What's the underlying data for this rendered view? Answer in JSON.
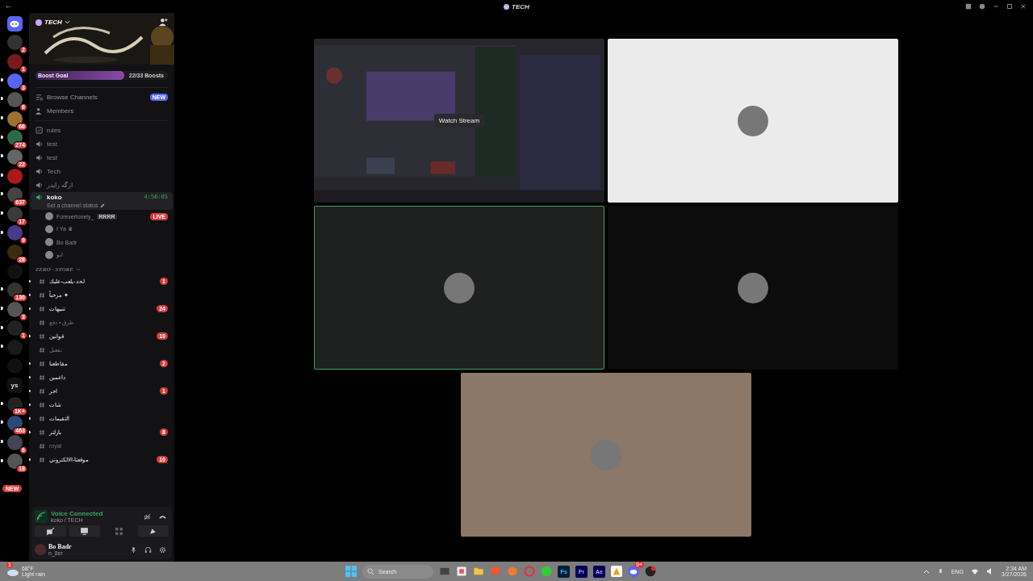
{
  "titlebar": {
    "title": "TECH"
  },
  "servers": [
    {
      "kind": "home",
      "unread": false
    },
    {
      "kind": "server",
      "badge": "2",
      "unread": false
    },
    {
      "kind": "server",
      "badge": "1",
      "unread": false
    },
    {
      "kind": "server",
      "badge": "3",
      "unread": true
    },
    {
      "kind": "server",
      "badge": "6",
      "unread": true
    },
    {
      "kind": "server",
      "badge": "66",
      "unread": true
    },
    {
      "kind": "server",
      "badge": "274",
      "unread": true
    },
    {
      "kind": "server",
      "badge": "22",
      "unread": true
    },
    {
      "kind": "server",
      "unread": true
    },
    {
      "kind": "server",
      "badge": "637",
      "unread": true
    },
    {
      "kind": "server",
      "badge": "17",
      "unread": true
    },
    {
      "kind": "server",
      "badge": "9",
      "unread": true
    },
    {
      "kind": "server",
      "badge": "28",
      "unread": false
    },
    {
      "kind": "server",
      "unread": false
    },
    {
      "kind": "server",
      "badge": "130",
      "unread": true
    },
    {
      "kind": "server",
      "badge": "3",
      "unread": true
    },
    {
      "kind": "server",
      "badge": "1",
      "unread": true
    },
    {
      "kind": "server",
      "unread": true
    },
    {
      "kind": "server",
      "unread": false
    },
    {
      "kind": "initials",
      "label": "ys",
      "unread": false
    },
    {
      "kind": "server",
      "badge": "1K+",
      "unread": true
    },
    {
      "kind": "server",
      "badge": "463",
      "unread": true
    },
    {
      "kind": "server",
      "badge": "6",
      "unread": true
    },
    {
      "kind": "server",
      "badge": "18",
      "unread": true
    }
  ],
  "new_pill": "NEW",
  "guild": {
    "name": "TECH",
    "boost_label": "Boost Goal",
    "level": 0.67,
    "boost_count": "22/33 Boosts"
  },
  "nav": [
    {
      "kind": "browse",
      "label": "Browse Channels",
      "badge": "NEW"
    },
    {
      "kind": "members",
      "label": "Members"
    }
  ],
  "channels": [
    {
      "kind": "rules",
      "name": "rules",
      "selected": false
    },
    {
      "kind": "voice",
      "name": "test",
      "selected": false
    },
    {
      "kind": "voice",
      "name": "test",
      "selected": false
    },
    {
      "kind": "voice",
      "name": "Tech",
      "selected": false
    },
    {
      "kind": "voice",
      "name": "ارگه رايدر",
      "selected": false
    },
    {
      "kind": "voice",
      "name": "koko",
      "selected": true,
      "timer": "4:56:05",
      "status": "Set a channel status"
    }
  ],
  "members": [
    {
      "name": "Foreverlonely_",
      "tag": "RRRR",
      "live": "LIVE"
    },
    {
      "name": "I Ya ♛"
    },
    {
      "name": "Bo Badr"
    },
    {
      "name": "ابو"
    }
  ],
  "category": "ZERO - STORE",
  "store_channels": [
    {
      "name": "لحد-يلعب-عليك",
      "unread": true,
      "badge": "1"
    },
    {
      "name": "مرحباً ✦",
      "unread": true
    },
    {
      "name": "تنبيهات",
      "unread": true,
      "badge": "24"
    },
    {
      "name": "طرق • دفع",
      "unread": false
    },
    {
      "name": "قوانين",
      "unread": true,
      "badge": "10"
    },
    {
      "name": "تفعيل",
      "unread": false
    },
    {
      "name": "مقاطعنا",
      "unread": true,
      "badge": "2"
    },
    {
      "name": "داعمين",
      "unread": true
    },
    {
      "name": "اجر",
      "unread": true,
      "badge": "1"
    },
    {
      "name": "شات",
      "unread": true
    },
    {
      "name": "التقيمات",
      "unread": true
    },
    {
      "name": "بازلتر",
      "unread": true,
      "badge": "8"
    },
    {
      "name": "royal",
      "unread": false
    },
    {
      "name": "موقعنا-الالكتروني",
      "unread": true,
      "badge": "10"
    }
  ],
  "voice_panel": {
    "status": "Voice Connected",
    "location": "koko / TECH"
  },
  "user": {
    "name": "Bo Badr",
    "status": "n_8er"
  },
  "tiles": [
    {
      "kind": "stream",
      "label": "Watch Stream",
      "speaking": false,
      "color": "#2b2b30"
    },
    {
      "kind": "camera",
      "speaking": false,
      "color": "#ebebeb"
    },
    {
      "kind": "camera",
      "speaking": true,
      "color": "#1f2020"
    },
    {
      "kind": "camera",
      "speaking": false,
      "color": "#0c0c0c"
    },
    {
      "kind": "camera",
      "speaking": false,
      "color": "#8c7868"
    }
  ],
  "taskbar": {
    "weather_badge": "1",
    "temp": "68°F",
    "weather": "Light rain",
    "search_placeholder": "Search",
    "apps": [
      "Ps",
      "Pr",
      "Ae"
    ],
    "discord_badge": "9+",
    "lang": "ENG",
    "time": "2:34 AM",
    "date": "3/27/2026"
  }
}
